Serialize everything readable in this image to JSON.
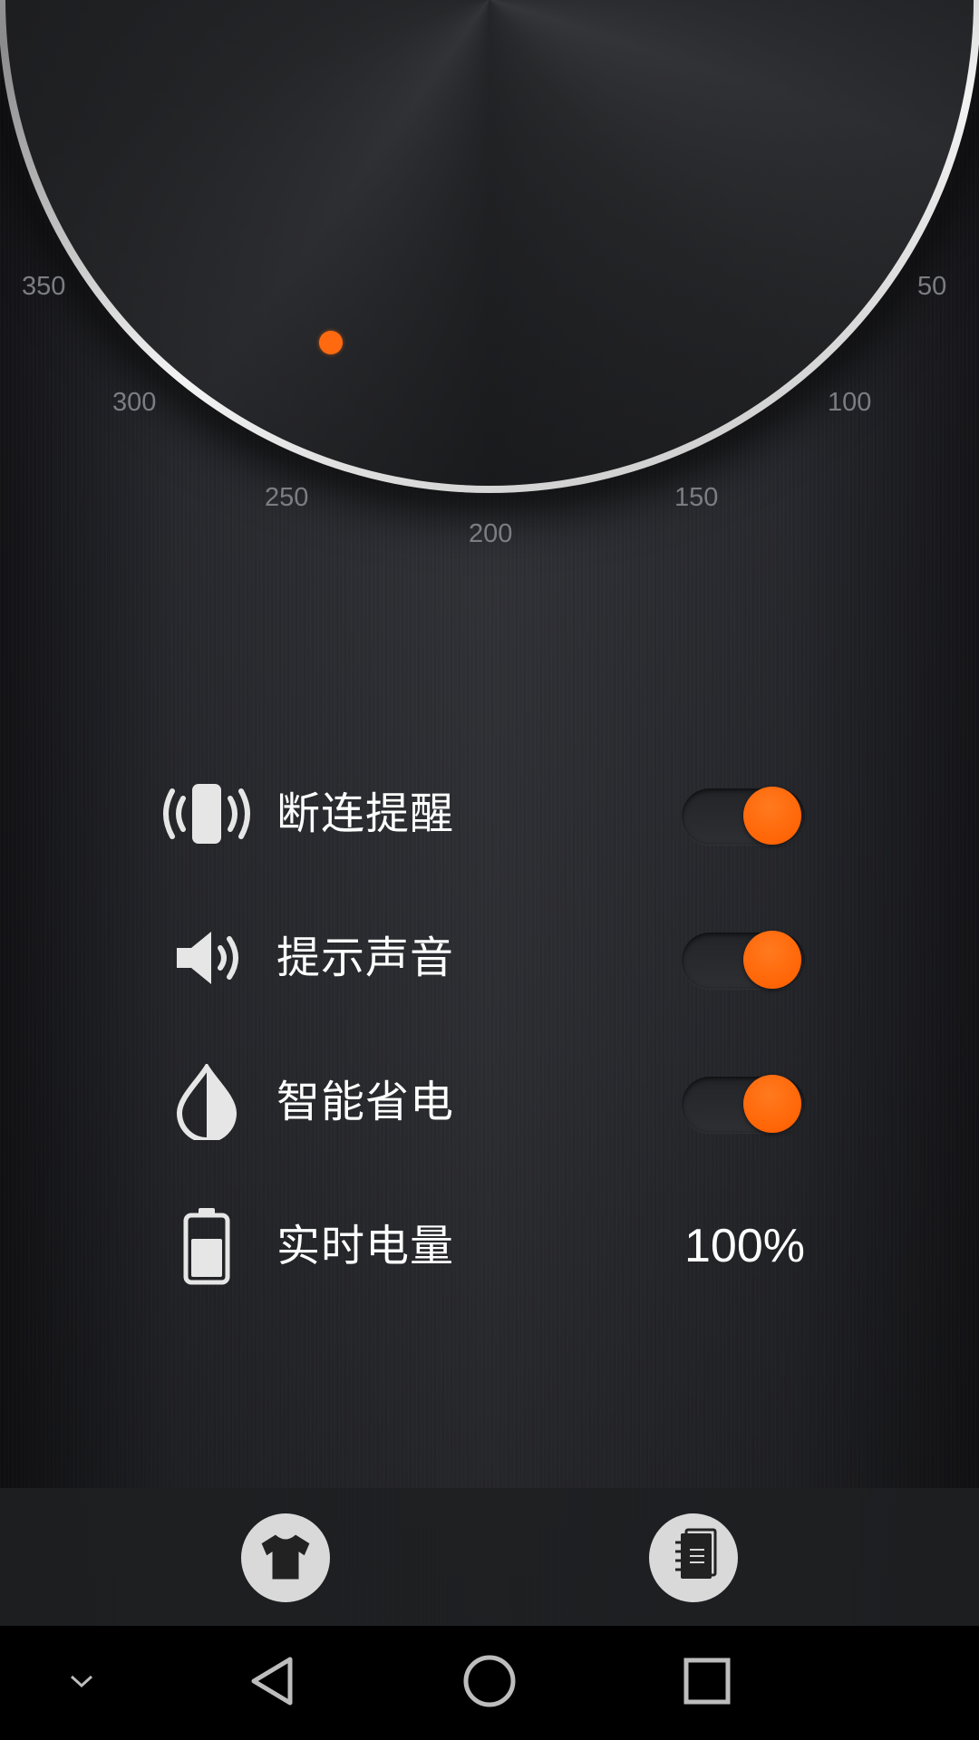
{
  "dial": {
    "ticks": [
      "350",
      "50",
      "300",
      "100",
      "250",
      "150",
      "200"
    ],
    "indicator_color": "#ff6a10"
  },
  "settings": [
    {
      "icon": "vibrate-alert-icon",
      "label": "断连提醒",
      "control": "toggle",
      "on": true
    },
    {
      "icon": "speaker-icon",
      "label": "提示声音",
      "control": "toggle",
      "on": true
    },
    {
      "icon": "power-saving-drop-icon",
      "label": "智能省电",
      "control": "toggle",
      "on": true
    },
    {
      "icon": "battery-icon",
      "label": "实时电量",
      "control": "value",
      "value": "100%"
    }
  ],
  "bottom_bar": {
    "buttons": [
      "shirt-icon",
      "notebook-icon"
    ]
  },
  "navbar": {
    "buttons": [
      "chevron-down-icon",
      "back-icon",
      "home-icon",
      "recents-icon"
    ]
  },
  "colors": {
    "accent": "#ff6a10",
    "text": "#ffffff",
    "tick": "#7c7d82"
  }
}
